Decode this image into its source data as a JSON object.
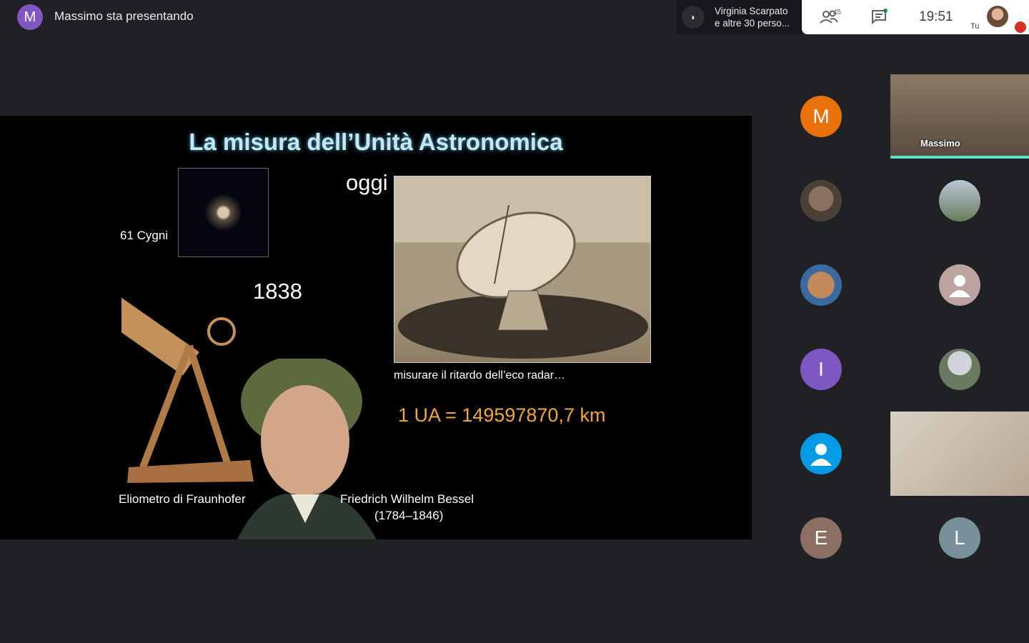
{
  "top_bar": {
    "presenter_initial": "M",
    "presenter_text": "Massimo sta presentando",
    "notification_line1": "Virginia Scarpato",
    "notification_line2": "e altre 30 perso...",
    "participant_count": "45",
    "time": "19:51",
    "self_label": "Tu"
  },
  "slide": {
    "title": "La misura dell’Unità Astronomica",
    "star_label": "61 Cygni",
    "year": "1838",
    "today_label": "oggi",
    "radar_caption": "misurare il ritardo dell’eco radar…",
    "au_value": "1 UA = 149597870,7 km",
    "heliometer_label": "Eliometro di Fraunhofer",
    "bessel_name": "Friedrich Wilhelm Bessel",
    "bessel_dates": "(1784–1846)"
  },
  "participants": {
    "active_speaker": "Massimo",
    "tiles": [
      {
        "initial": "M",
        "color": "#e8710a"
      },
      {
        "initial": "I",
        "color": "#7e57c2"
      },
      {
        "initial": "E",
        "color": "#8d6e63"
      },
      {
        "initial": "L",
        "color": "#78909c"
      }
    ]
  }
}
